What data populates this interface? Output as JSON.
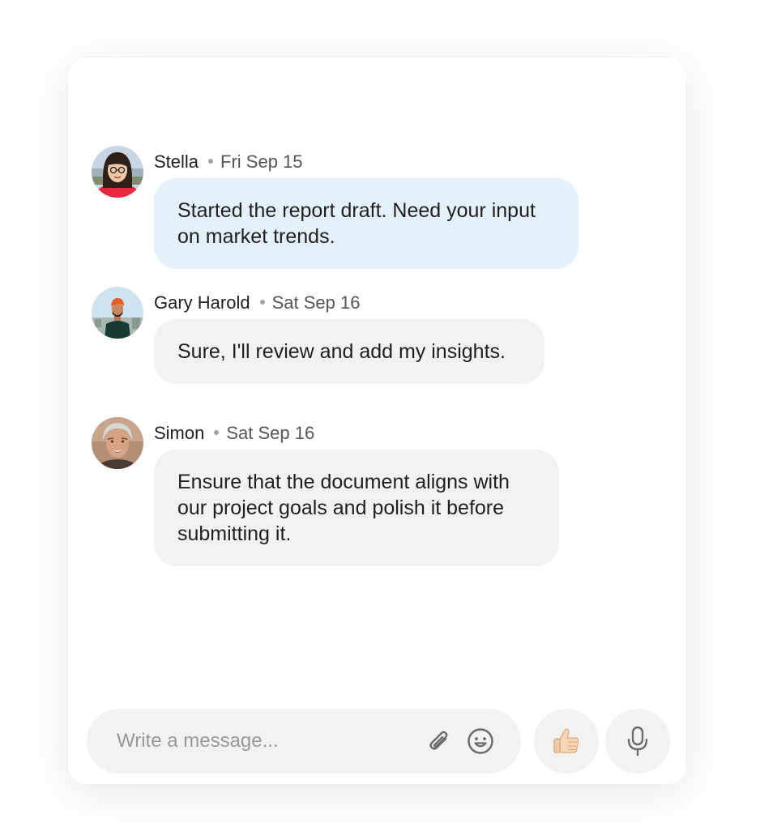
{
  "messages": [
    {
      "author": "Stella",
      "date": "Fri Sep 15",
      "text": "Started the report draft. Need your input on market trends."
    },
    {
      "author": "Gary Harold",
      "date": "Sat Sep 16",
      "text": "Sure, I'll review and add my insights."
    },
    {
      "author": "Simon",
      "date": "Sat Sep 16",
      "text": "Ensure that the document aligns with our project goals and polish it before submitting it."
    }
  ],
  "composer": {
    "placeholder": "Write a message...",
    "value": ""
  },
  "icons": {
    "attach": "paperclip-icon",
    "emoji": "smiley-icon",
    "like": "thumbs-up-icon",
    "voice": "microphone-icon"
  },
  "colors": {
    "highlight_bubble": "#e4f1fd",
    "bubble": "#f2f2f2",
    "text": "#1f1f1f",
    "secondary_text": "#555555"
  }
}
